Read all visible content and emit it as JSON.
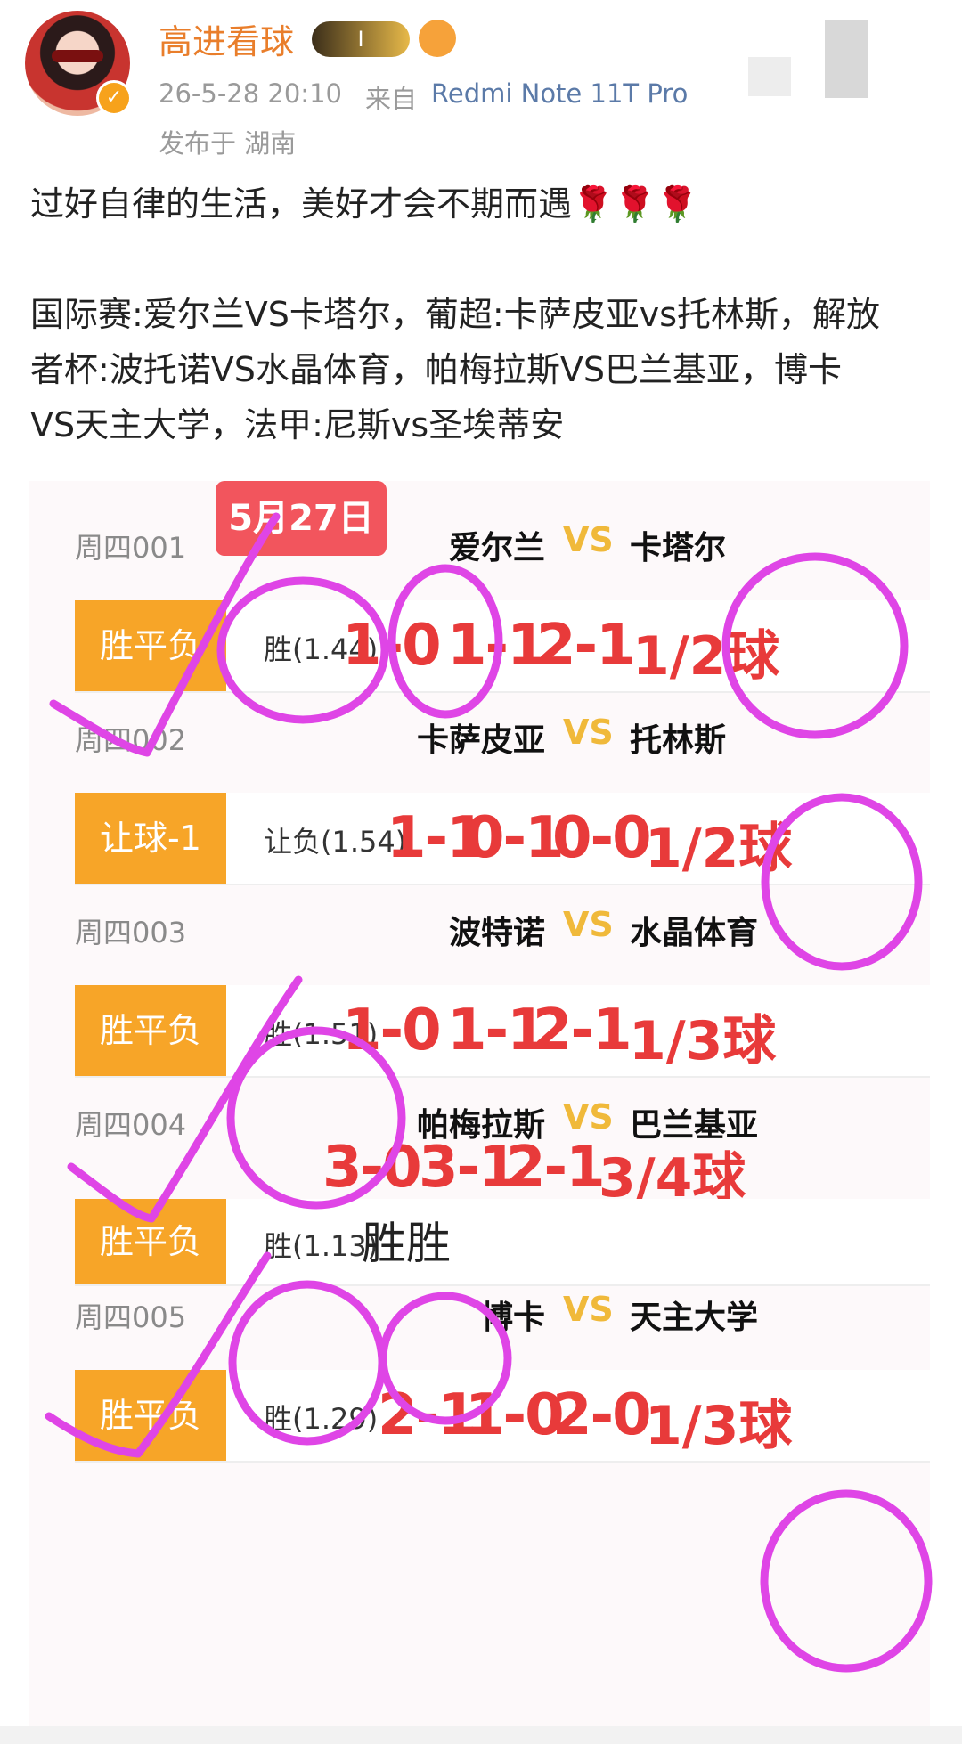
{
  "post": {
    "username": "高进看球",
    "badge_text": "I",
    "time": "26-5-28 20:10",
    "source_label": "来自",
    "device": "Redmi Note 11T Pro",
    "location": "发布于 湖南",
    "line1": "过好自律的生活，美好才会不期而遇",
    "roses": "🌹🌹🌹",
    "line2": "国际赛:爱尔兰VS卡塔尔，葡超:卡萨皮亚vs托林斯，解放",
    "line3": "者杯:波托诺VS水晶体育，帕梅拉斯VS巴兰基亚，博卡",
    "line4": "VS天主大学，法甲:尼斯vs圣埃蒂安"
  },
  "card": {
    "date_tag": "5月27日",
    "matches": [
      {
        "id": "周四001",
        "home": "爱尔兰",
        "vs": "VS",
        "away": "卡塔尔",
        "bet_type": "胜平负",
        "pick": "胜(1.44)",
        "scores": [
          "1-0",
          "1-1",
          "2-1"
        ],
        "goals": "1/2球"
      },
      {
        "id": "周四002",
        "home": "卡萨皮亚",
        "vs": "VS",
        "away": "托林斯",
        "bet_type": "让球-1",
        "pick": "让负(1.54)",
        "scores": [
          "1-1",
          "0-1",
          "0-0"
        ],
        "goals": "1/2球"
      },
      {
        "id": "周四003",
        "home": "波特诺",
        "vs": "VS",
        "away": "水晶体育",
        "bet_type": "胜平负",
        "pick": "胜(1.51)",
        "scores": [
          "1-0",
          "1-1",
          "2-1"
        ],
        "goals": "1/3球"
      },
      {
        "id": "周四004",
        "home": "帕梅拉斯",
        "vs": "VS",
        "away": "巴兰基亚",
        "bet_type": "胜平负",
        "pick": "胜(1.13)",
        "scores": [
          "3-0",
          "3-1",
          "2-1"
        ],
        "goals": "3/4球",
        "half_full": "胜胜"
      },
      {
        "id": "周四005",
        "home": "博卡",
        "vs": "VS",
        "away": "天主大学",
        "bet_type": "胜平负",
        "pick": "胜(1.29)",
        "scores": [
          "2-1",
          "1-0",
          "2-0"
        ],
        "goals": "1/3球"
      }
    ]
  },
  "colors": {
    "username": "#e97e2b",
    "accent_orange": "#f7a528",
    "score_red": "#e83a3a",
    "date_tag": "#f2555d",
    "vs_gold": "#f0b93a",
    "annotation": "#df45e6"
  }
}
